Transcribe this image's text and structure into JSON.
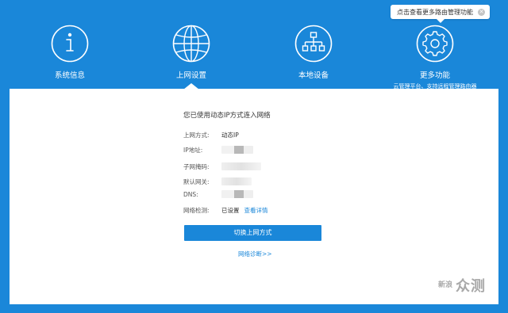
{
  "tooltip": {
    "text": "点击查看更多路由管理功能",
    "close_icon": "close-icon"
  },
  "nav": {
    "items": [
      {
        "label": "系统信息",
        "icon": "info-icon"
      },
      {
        "label": "上网设置",
        "icon": "globe-icon",
        "active": true
      },
      {
        "label": "本地设备",
        "icon": "network-tree-icon"
      },
      {
        "label": "更多功能",
        "icon": "gear-icon",
        "sub": "云管理平台、支持远程管理路由器"
      }
    ]
  },
  "panel": {
    "title": "您已使用动态IP方式连入网络",
    "rows": [
      {
        "label": "上网方式:",
        "value": "动态IP"
      },
      {
        "label": "IP地址:",
        "value": ""
      },
      {
        "label": "子网掩码:",
        "value": ""
      },
      {
        "label": "默认网关:",
        "value": ""
      },
      {
        "label": "DNS:",
        "value": ""
      },
      {
        "label": "网络检测:",
        "value": "已设置",
        "link": "查看详情"
      }
    ],
    "switch_button": "切换上网方式",
    "diagnose_link": "网络诊断>>"
  },
  "watermark": {
    "badge": "新浪",
    "text": "众测"
  },
  "colors": {
    "brand_blue": "#1a87d9",
    "panel_bg": "#ffffff"
  }
}
